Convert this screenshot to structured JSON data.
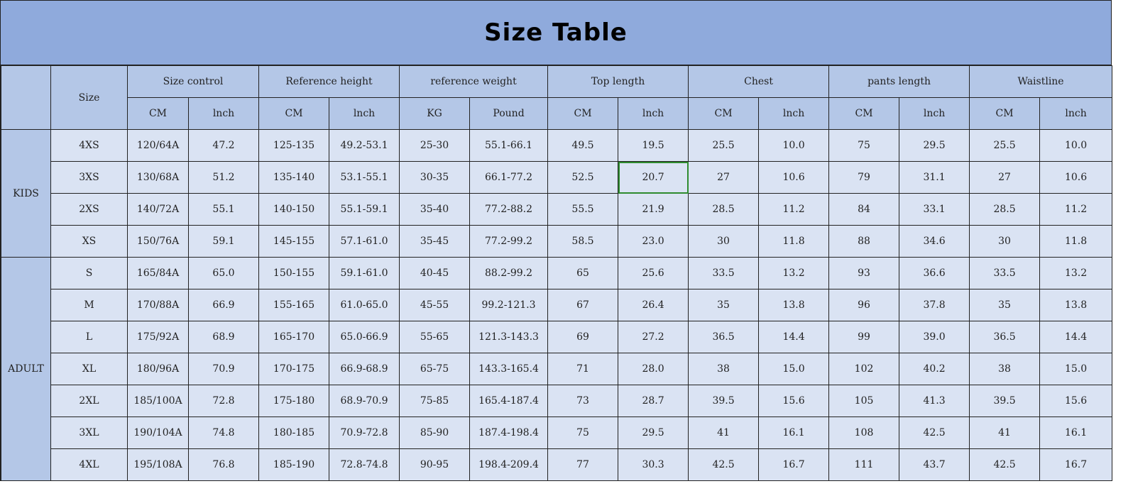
{
  "title": "Size Table",
  "headers": {
    "size": "Size",
    "groups": [
      "Size control",
      "Reference height",
      "reference weight",
      "Top length",
      "Chest",
      "pants length",
      "Waistline"
    ],
    "units": [
      "CM",
      "lnch",
      "CM",
      "lnch",
      "KG",
      "Pound",
      "CM",
      "lnch",
      "CM",
      "lnch",
      "CM",
      "lnch",
      "CM",
      "lnch"
    ]
  },
  "sections": [
    {
      "label": "KIDS",
      "rows": [
        [
          "4XS",
          "120/64A",
          "47.2",
          "125-135",
          "49.2-53.1",
          "25-30",
          "55.1-66.1",
          "49.5",
          "19.5",
          "25.5",
          "10.0",
          "75",
          "29.5",
          "25.5",
          "10.0"
        ],
        [
          "3XS",
          "130/68A",
          "51.2",
          "135-140",
          "53.1-55.1",
          "30-35",
          "66.1-77.2",
          "52.5",
          "20.7",
          "27",
          "10.6",
          "79",
          "31.1",
          "27",
          "10.6"
        ],
        [
          "2XS",
          "140/72A",
          "55.1",
          "140-150",
          "55.1-59.1",
          "35-40",
          "77.2-88.2",
          "55.5",
          "21.9",
          "28.5",
          "11.2",
          "84",
          "33.1",
          "28.5",
          "11.2"
        ],
        [
          "XS",
          "150/76A",
          "59.1",
          "145-155",
          "57.1-61.0",
          "35-45",
          "77.2-99.2",
          "58.5",
          "23.0",
          "30",
          "11.8",
          "88",
          "34.6",
          "30",
          "11.8"
        ]
      ]
    },
    {
      "label": "ADULT",
      "rows": [
        [
          "S",
          "165/84A",
          "65.0",
          "150-155",
          "59.1-61.0",
          "40-45",
          "88.2-99.2",
          "65",
          "25.6",
          "33.5",
          "13.2",
          "93",
          "36.6",
          "33.5",
          "13.2"
        ],
        [
          "M",
          "170/88A",
          "66.9",
          "155-165",
          "61.0-65.0",
          "45-55",
          "99.2-121.3",
          "67",
          "26.4",
          "35",
          "13.8",
          "96",
          "37.8",
          "35",
          "13.8"
        ],
        [
          "L",
          "175/92A",
          "68.9",
          "165-170",
          "65.0-66.9",
          "55-65",
          "121.3-143.3",
          "69",
          "27.2",
          "36.5",
          "14.4",
          "99",
          "39.0",
          "36.5",
          "14.4"
        ],
        [
          "XL",
          "180/96A",
          "70.9",
          "170-175",
          "66.9-68.9",
          "65-75",
          "143.3-165.4",
          "71",
          "28.0",
          "38",
          "15.0",
          "102",
          "40.2",
          "38",
          "15.0"
        ],
        [
          "2XL",
          "185/100A",
          "72.8",
          "175-180",
          "68.9-70.9",
          "75-85",
          "165.4-187.4",
          "73",
          "28.7",
          "39.5",
          "15.6",
          "105",
          "41.3",
          "39.5",
          "15.6"
        ],
        [
          "3XL",
          "190/104A",
          "74.8",
          "180-185",
          "70.9-72.8",
          "85-90",
          "187.4-198.4",
          "75",
          "29.5",
          "41",
          "16.1",
          "108",
          "42.5",
          "41",
          "16.1"
        ],
        [
          "4XL",
          "195/108A",
          "76.8",
          "185-190",
          "72.8-74.8",
          "90-95",
          "198.4-209.4",
          "77",
          "30.3",
          "42.5",
          "16.7",
          "111",
          "43.7",
          "42.5",
          "16.7"
        ]
      ]
    }
  ],
  "selected_cell": {
    "section": 0,
    "row": 1,
    "col": 8
  },
  "colors": {
    "title_bg": "#8faadc",
    "header_bg": "#b4c7e7",
    "cell_bg": "#dae3f3",
    "selection": "#2e8b2e"
  }
}
